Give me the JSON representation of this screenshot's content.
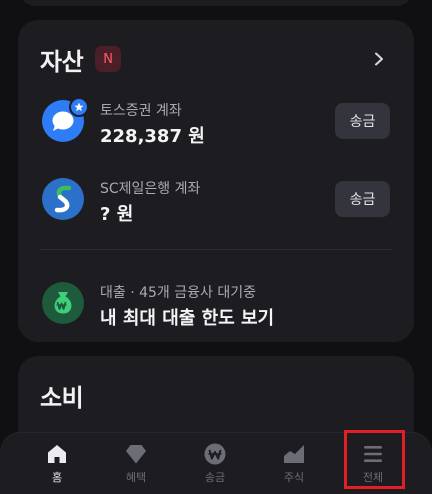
{
  "assets": {
    "title": "자산",
    "badge": "N",
    "accounts": [
      {
        "label": "토스증권 계좌",
        "value": "228,387 원",
        "button": "송금"
      },
      {
        "label": "SC제일은행 계좌",
        "value": "? 원",
        "button": "송금"
      }
    ],
    "loan": {
      "label": "대출 · 45개 금융사 대기중",
      "value": "내 최대 대출 한도 보기"
    }
  },
  "spending": {
    "title": "소비"
  },
  "bottom_nav": {
    "items": [
      {
        "label": "홈",
        "icon": "home-icon",
        "active": true
      },
      {
        "label": "혜택",
        "icon": "gem-icon"
      },
      {
        "label": "송금",
        "icon": "won-transfer-icon"
      },
      {
        "label": "주식",
        "icon": "stock-chart-icon"
      },
      {
        "label": "전체",
        "icon": "menu-icon"
      }
    ]
  },
  "colors": {
    "background": "#101013",
    "card": "#1c1c21",
    "toss_blue": "#2e7cf6",
    "new_badge": "#ff5c6c",
    "highlight": "#e51e25"
  }
}
